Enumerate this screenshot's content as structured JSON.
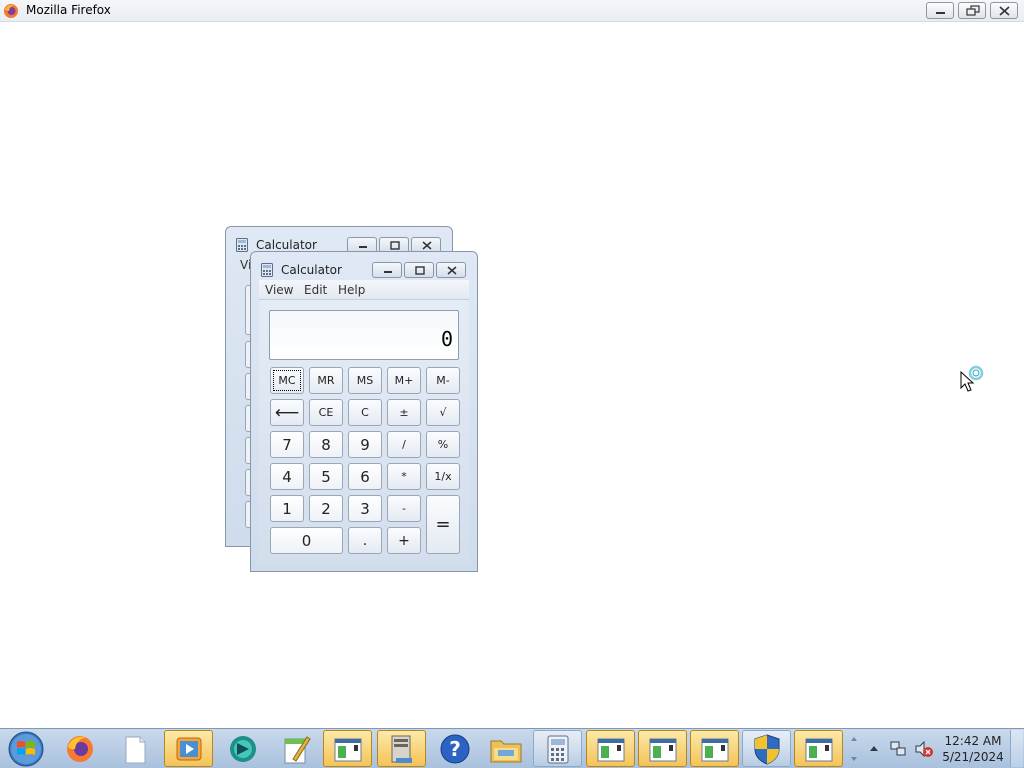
{
  "browser": {
    "title": "Mozilla Firefox"
  },
  "calculator_back": {
    "title": "Calculator",
    "menu_stub": "Vi"
  },
  "calculator": {
    "title": "Calculator",
    "menu": [
      "View",
      "Edit",
      "Help"
    ],
    "display": "0",
    "memory_keys": [
      "MC",
      "MR",
      "MS",
      "M+",
      "M-"
    ],
    "row2": [
      "⟵",
      "CE",
      "C",
      "±",
      "√"
    ],
    "row3": [
      "7",
      "8",
      "9",
      "/",
      "%"
    ],
    "row4": [
      "4",
      "5",
      "6",
      "*",
      "1/x"
    ],
    "row5": [
      "1",
      "2",
      "3",
      "-"
    ],
    "row6": [
      "0",
      ".",
      "+"
    ],
    "equals": "="
  },
  "taskbar": {
    "clock_time": "12:42 AM",
    "clock_date": "5/21/2024",
    "colors": {
      "active_button": "#f4c357",
      "taskbar_bg": "#b9cde5"
    }
  }
}
